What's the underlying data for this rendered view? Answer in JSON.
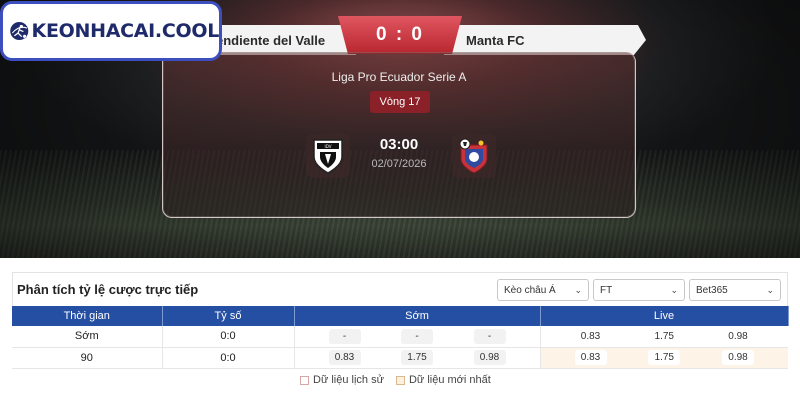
{
  "brand": {
    "logo_text": "KEONHACAI.COOL"
  },
  "match": {
    "home_team": "endiente del Valle",
    "away_team": "Manta FC",
    "score": "0 : 0",
    "league": "Liga Pro Ecuador Serie A",
    "round": "Vòng 17",
    "kickoff_time": "03:00",
    "kickoff_date": "02/07/2026"
  },
  "odds": {
    "title": "Phân tích tỷ lệ cược trực tiếp",
    "filters": {
      "market": "Kèo châu Á",
      "period": "FT",
      "bookmaker": "Bet365"
    },
    "columns": [
      "Thời gian",
      "Tỷ số",
      "Sớm",
      "Live"
    ],
    "rows": [
      {
        "time": "Sớm",
        "score": "0:0",
        "early": [
          "-",
          "-",
          "-"
        ],
        "live": [
          "0.83",
          "1.75",
          "0.98"
        ]
      },
      {
        "time": "90",
        "score": "0:0",
        "early": [
          "0.83",
          "1.75",
          "0.98"
        ],
        "live": [
          "0.83",
          "1.75",
          "0.98"
        ]
      }
    ],
    "legend": {
      "history": "Dữ liệu lịch sử",
      "latest": "Dữ liệu mới nhất"
    }
  },
  "colors": {
    "header_blue": "#254fa3",
    "score_red": "#c8343d",
    "round_red": "#8a2028",
    "latest_highlight": "#fdf3e6"
  }
}
